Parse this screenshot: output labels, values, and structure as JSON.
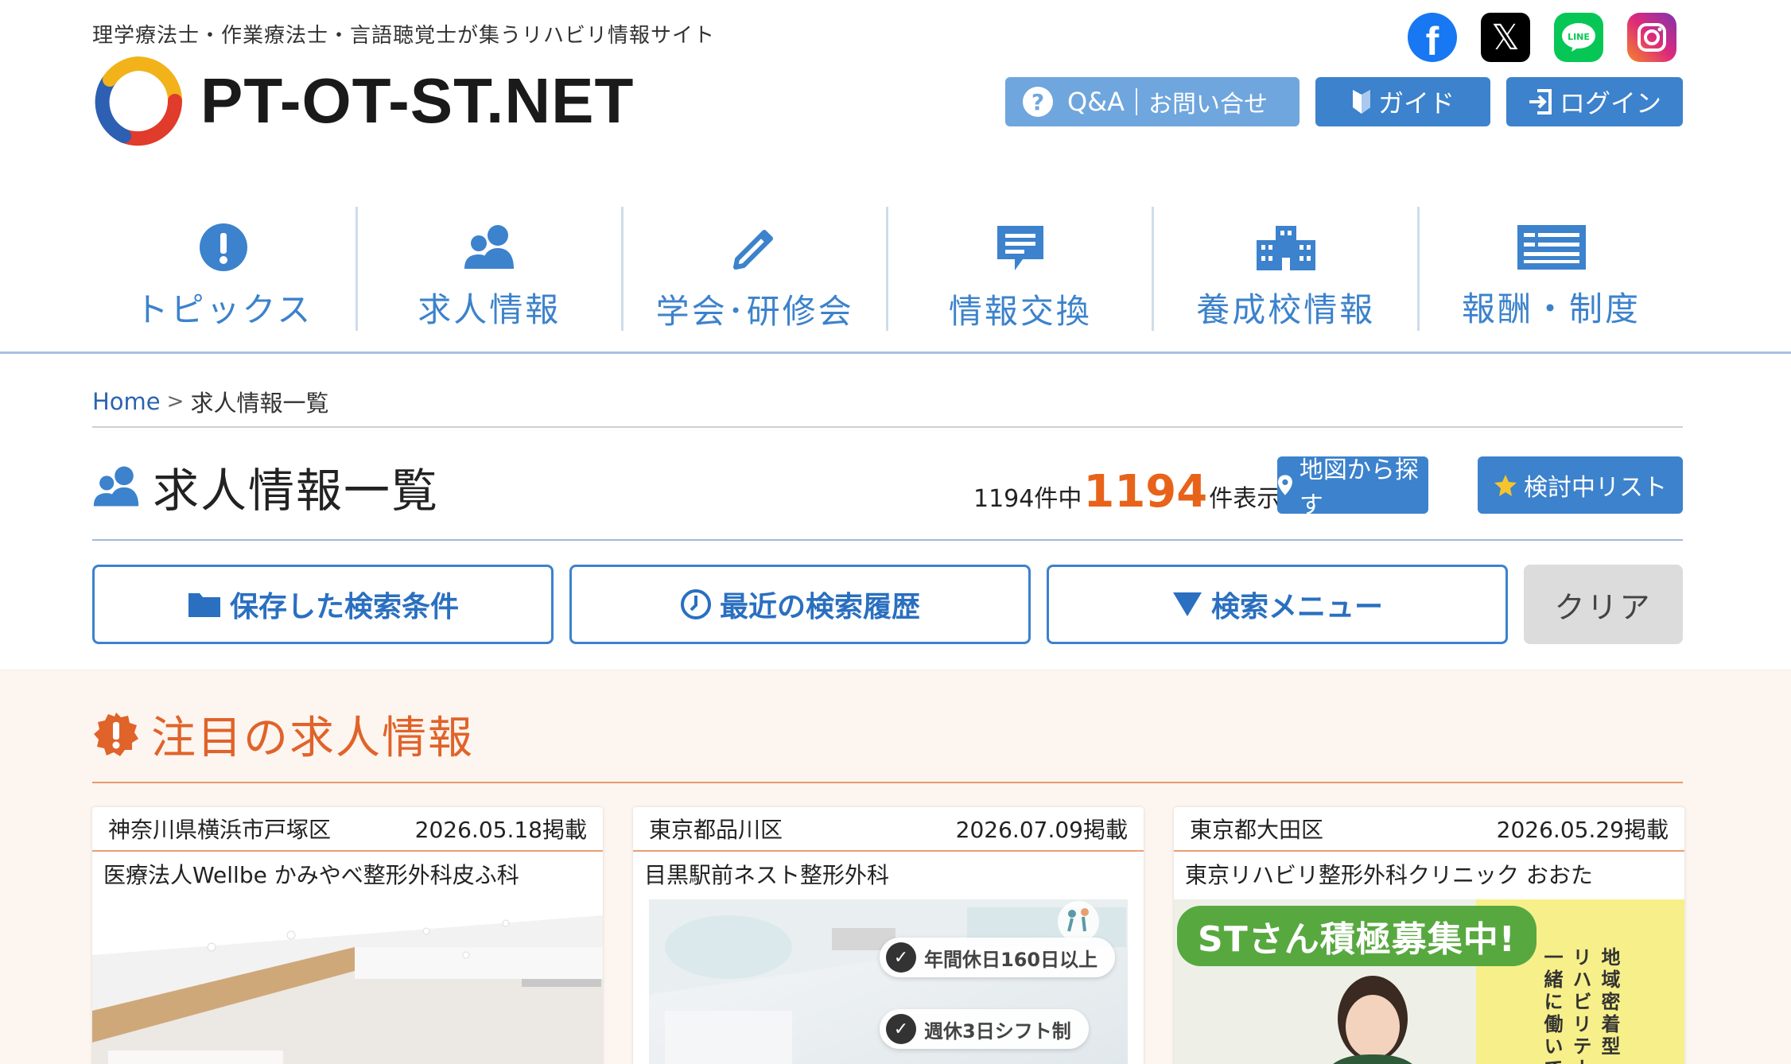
{
  "header": {
    "tagline": "理学療法士・作業療法士・言語聴覚士が集うリハビリ情報サイト",
    "logo_text": "PT-OT-ST.NET",
    "social": [
      {
        "name": "facebook",
        "glyph": "f"
      },
      {
        "name": "x",
        "glyph": "𝕏"
      },
      {
        "name": "line",
        "glyph": "LINE"
      },
      {
        "name": "instagram",
        "glyph": ""
      }
    ],
    "qa_label": "Q&A",
    "contact_label": "お問い合せ",
    "guide_label": "ガイド",
    "login_label": "ログイン"
  },
  "nav": {
    "items": [
      {
        "label": "トピックス",
        "icon": "exclamation-icon"
      },
      {
        "label": "求人情報",
        "icon": "users-icon"
      },
      {
        "label": "学会･研修会",
        "icon": "pencil-icon"
      },
      {
        "label": "情報交換",
        "icon": "chat-icon"
      },
      {
        "label": "養成校情報",
        "icon": "school-icon"
      },
      {
        "label": "報酬・制度",
        "icon": "list-icon"
      }
    ]
  },
  "breadcrumb": {
    "home": "Home",
    "sep": ">",
    "current": "求人情報一覧"
  },
  "page": {
    "title": "求人情報一覧",
    "count_prefix": "1194件中",
    "count_shown": "1194",
    "count_suffix": "件表示",
    "map_button": "地図から探す",
    "fav_button": "検討中リスト"
  },
  "search": {
    "saved": "保存した検索条件",
    "recent": "最近の検索履歴",
    "menu": "検索メニュー",
    "clear": "クリア"
  },
  "featured": {
    "title": "注目の求人情報",
    "cards": [
      {
        "location": "神奈川県横浜市戸塚区",
        "date": "2026.05.18掲載",
        "name": "医療法人Wellbe かみやべ整形外科皮ふ科"
      },
      {
        "location": "東京都品川区",
        "date": "2026.07.09掲載",
        "name": "目黒駅前ネスト整形外科",
        "tags": [
          "年間休日160日以上",
          "週休3日シフト制"
        ]
      },
      {
        "location": "東京都大田区",
        "date": "2026.05.29掲載",
        "name": "東京リハビリ整形外科クリニック おおた",
        "banner": "STさん積極募集中!",
        "vertical": [
          "地域密着型",
          "リハビリテー",
          "一緒に働いて"
        ]
      }
    ]
  },
  "colors": {
    "primary": "#3c82cc",
    "accent_orange": "#e0632a",
    "featured_bg": "#fdf5ef"
  }
}
